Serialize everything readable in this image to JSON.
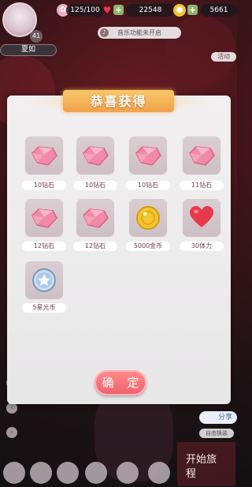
{
  "status": {
    "level": "41",
    "name": "夏如",
    "stamina": "125/100",
    "gold": "22548",
    "diamond": "5661"
  },
  "notice": {
    "music_disabled": "音乐功能未开启"
  },
  "side": {
    "activity_label": "活动"
  },
  "dialog": {
    "title": "恭喜获得",
    "confirm_label": "确 定",
    "items": [
      {
        "label": "10钻石",
        "icon": "diamond-icon"
      },
      {
        "label": "10钻石",
        "icon": "diamond-icon"
      },
      {
        "label": "10钻石",
        "icon": "diamond-icon"
      },
      {
        "label": "11钻石",
        "icon": "diamond-icon"
      },
      {
        "label": "12钻石",
        "icon": "diamond-icon"
      },
      {
        "label": "12钻石",
        "icon": "diamond-icon"
      },
      {
        "label": "5000金币",
        "icon": "gold-coin-icon"
      },
      {
        "label": "30体力",
        "icon": "heart-icon"
      },
      {
        "label": "5星光币",
        "icon": "star-coin-icon"
      }
    ]
  },
  "bottom": {
    "share_label": "分享",
    "share_sub": "自由换装",
    "start_label": "开始旅程"
  },
  "colors": {
    "accent": "#ef5f6b",
    "banner": "#f0a14c",
    "diamond": "#f08aa8",
    "gold": "#f2c531",
    "heart": "#e8394d",
    "star_coin": "#a9c9ec"
  }
}
